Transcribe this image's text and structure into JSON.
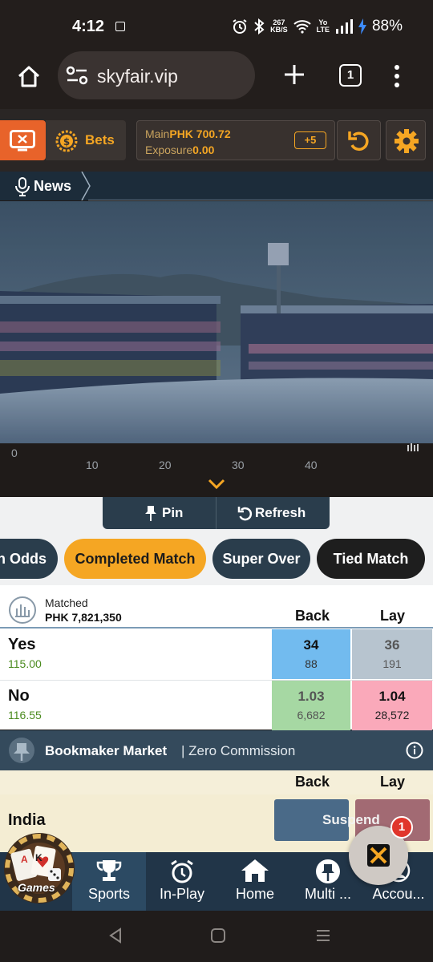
{
  "status_bar": {
    "time": "4:12",
    "net_speed_top": "267",
    "net_speed_bottom": "KB/S",
    "lte_top": "Yo",
    "lte_bottom": "LTE",
    "battery": "88%"
  },
  "browser": {
    "url": "skyfair.vip",
    "tab_count": "1"
  },
  "header": {
    "bets_label": "Bets",
    "main_label": "Main",
    "main_value": "PHK 700.72",
    "exposure_label": "Exposure",
    "exposure_value": "0.00",
    "plus_badge": "+5"
  },
  "news": {
    "label": "News"
  },
  "timeline": {
    "ticks": [
      "0",
      "10",
      "20",
      "30",
      "40"
    ]
  },
  "actions": {
    "pin_label": "Pin",
    "refresh_label": "Refresh"
  },
  "market_tabs": [
    {
      "label": "h Odds",
      "active": false
    },
    {
      "label": "Completed Match",
      "active": true
    },
    {
      "label": "Super Over",
      "active": false
    },
    {
      "label": "Tied Match",
      "active": false
    }
  ],
  "market": {
    "matched_label": "Matched",
    "matched_value": "PHK 7,821,350",
    "back_label": "Back",
    "lay_label": "Lay",
    "runners": [
      {
        "name": "Yes",
        "sub": "115.00",
        "back_price": "34",
        "back_size": "88",
        "lay_price": "36",
        "lay_size": "191"
      },
      {
        "name": "No",
        "sub": "116.55",
        "back_price": "1.03",
        "back_size": "6,682",
        "lay_price": "1.04",
        "lay_size": "28,572"
      }
    ]
  },
  "bookmaker": {
    "title": "Bookmaker Market",
    "subtitle": "| Zero Commission",
    "back_label": "Back",
    "lay_label": "Lay",
    "runner": "India",
    "status": "Suspend"
  },
  "games_badge": {
    "label": "Games",
    "card_rank": "A",
    "card_rank2": "K"
  },
  "floating": {
    "notification_count": "1"
  },
  "bottom_nav": [
    {
      "label": "Sports",
      "icon": "trophy-icon",
      "active": true
    },
    {
      "label": "In-Play",
      "icon": "alarm-clock-icon",
      "active": false
    },
    {
      "label": "Home",
      "icon": "home-icon",
      "active": false
    },
    {
      "label": "Multi ...",
      "icon": "pin-icon",
      "active": false
    },
    {
      "label": "Accou...",
      "icon": "account-icon",
      "active": false
    }
  ],
  "colors": {
    "accent_orange": "#f5a623",
    "back_blue": "#72bbef",
    "lay_pink": "#faa9ba",
    "back_green_suspended": "#a6d8a3",
    "lay_grey_suspended": "#b7c4cf"
  }
}
